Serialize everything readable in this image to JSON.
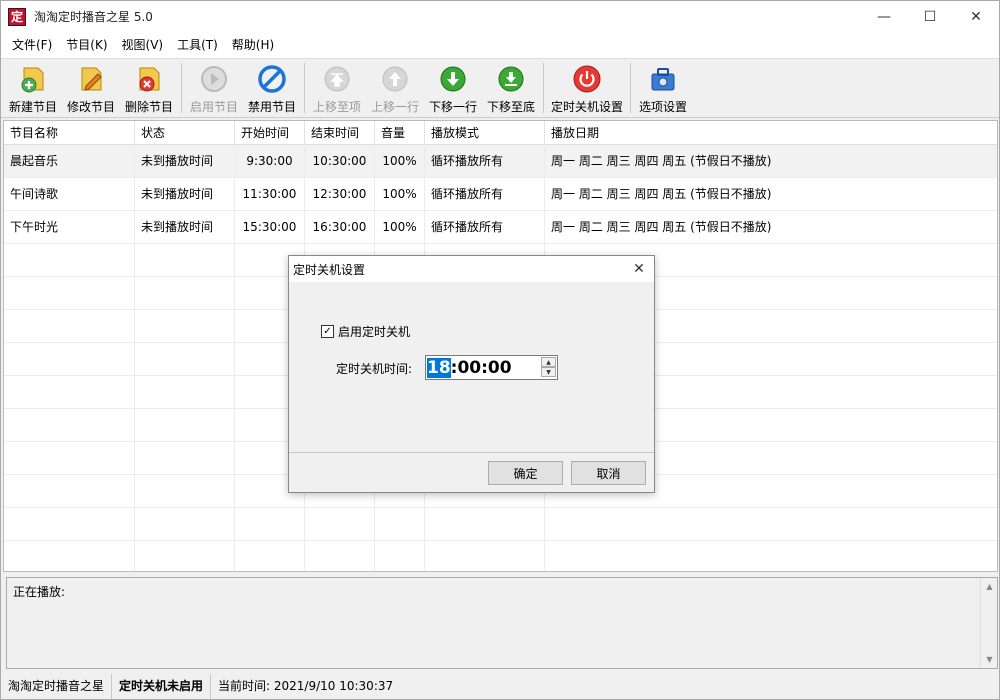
{
  "window": {
    "title": "淘淘定时播音之星 5.0",
    "app_icon_char": "定",
    "controls": {
      "minimize": "—",
      "maximize": "☐",
      "close": "✕"
    }
  },
  "menu": [
    {
      "label": "文件(F)"
    },
    {
      "label": "节目(K)"
    },
    {
      "label": "视图(V)"
    },
    {
      "label": "工具(T)"
    },
    {
      "label": "帮助(H)"
    }
  ],
  "toolbar": {
    "new": "新建节目",
    "edit": "修改节目",
    "delete": "删除节目",
    "enable": "启用节目",
    "disable": "禁用节目",
    "move_top": "上移至项",
    "move_up": "上移一行",
    "move_down": "下移一行",
    "move_bottom": "下移至底",
    "shutdown": "定时关机设置",
    "options": "选项设置"
  },
  "table": {
    "headers": [
      "节目名称",
      "状态",
      "开始时间",
      "结束时间",
      "音量",
      "播放模式",
      "播放日期"
    ],
    "rows": [
      [
        "晨起音乐",
        "未到播放时间",
        "9:30:00",
        "10:30:00",
        "100%",
        "循环播放所有",
        "周一 周二 周三 周四 周五 (节假日不播放)"
      ],
      [
        "午间诗歌",
        "未到播放时间",
        "11:30:00",
        "12:30:00",
        "100%",
        "循环播放所有",
        "周一 周二 周三 周四 周五 (节假日不播放)"
      ],
      [
        "下午时光",
        "未到播放时间",
        "15:30:00",
        "16:30:00",
        "100%",
        "循环播放所有",
        "周一 周二 周三 周四 周五 (节假日不播放)"
      ]
    ]
  },
  "now_playing": {
    "label": "正在播放:"
  },
  "statusbar": {
    "app": "淘淘定时播音之星",
    "shutdown_status": "定时关机未启用",
    "current_time": "当前时间:  2021/9/10 10:30:37"
  },
  "dialog": {
    "title": "定时关机设置",
    "enable_label": "启用定时关机",
    "enable_checked": true,
    "time_label": "定时关机时间:",
    "time_hour": "18",
    "time_rest": ":00:00",
    "ok": "确定",
    "cancel": "取消"
  },
  "colors": {
    "selection": "#0078d7",
    "new_icon": "#4caf50",
    "edit_icon": "#f2c94c",
    "delete_icon": "#e53935",
    "disable_icon": "#1e73d8",
    "move_icon": "#3aa935",
    "shutdown_icon": "#e53935"
  }
}
